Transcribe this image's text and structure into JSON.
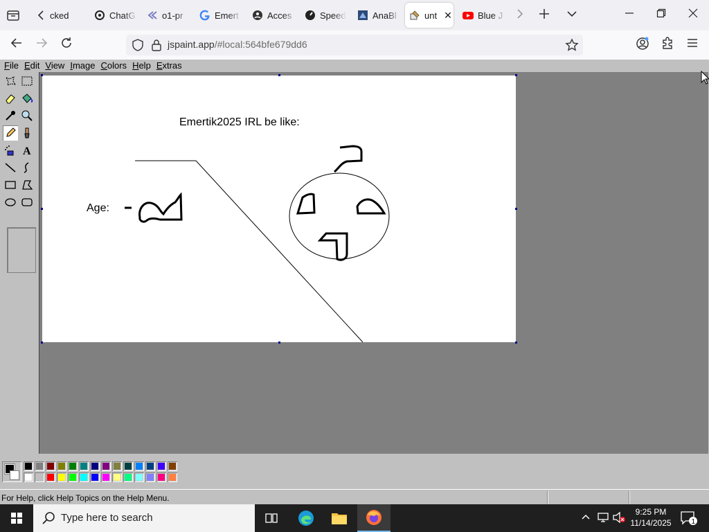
{
  "browser": {
    "tabs": [
      {
        "title": "cked",
        "icon": "tab-icon"
      },
      {
        "title": "ChatG",
        "icon": "openai-icon"
      },
      {
        "title": "o1-pr",
        "icon": "chevrons-icon"
      },
      {
        "title": "Emert",
        "icon": "google-icon"
      },
      {
        "title": "Acces",
        "icon": "puzzle-icon"
      },
      {
        "title": "Speed",
        "icon": "speedtest-icon"
      },
      {
        "title": "AnaBl",
        "icon": "anablock-icon"
      },
      {
        "title": "unt",
        "icon": "jspaint-icon",
        "active": true
      },
      {
        "title": "Blue J",
        "icon": "youtube-icon"
      }
    ],
    "url_host": "jspaint.app",
    "url_path": "/#local:564bfe679dd6"
  },
  "paint": {
    "menus": [
      {
        "label": "File",
        "accel": "F",
        "rest": "ile"
      },
      {
        "label": "Edit",
        "accel": "E",
        "rest": "dit"
      },
      {
        "label": "View",
        "accel": "V",
        "rest": "iew"
      },
      {
        "label": "Image",
        "accel": "I",
        "rest": "mage"
      },
      {
        "label": "Colors",
        "accel": "C",
        "rest": "olors"
      },
      {
        "label": "Help",
        "accel": "H",
        "rest": "elp"
      },
      {
        "label": "Extras",
        "accel": "E",
        "rest": "xtras"
      }
    ],
    "canvas_text": {
      "title": "Emertik2025 IRL be like:",
      "age_label": "Age:"
    },
    "palette": [
      "#000000",
      "#808080",
      "#800000",
      "#808000",
      "#008000",
      "#008080",
      "#000080",
      "#800080",
      "#808040",
      "#004040",
      "#0080ff",
      "#004080",
      "#4000ff",
      "#804000",
      "#ffffff",
      "#c0c0c0",
      "#ff0000",
      "#ffff00",
      "#00ff00",
      "#00ffff",
      "#0000ff",
      "#ff00ff",
      "#ffff80",
      "#00ff80",
      "#80ffff",
      "#8080ff",
      "#ff0080",
      "#ff8040"
    ],
    "status": "For Help, click Help Topics on the Help Menu."
  },
  "taskbar": {
    "search_placeholder": "Type here to search",
    "time": "9:25 PM",
    "date": "11/14/2025",
    "notification_count": "1"
  }
}
